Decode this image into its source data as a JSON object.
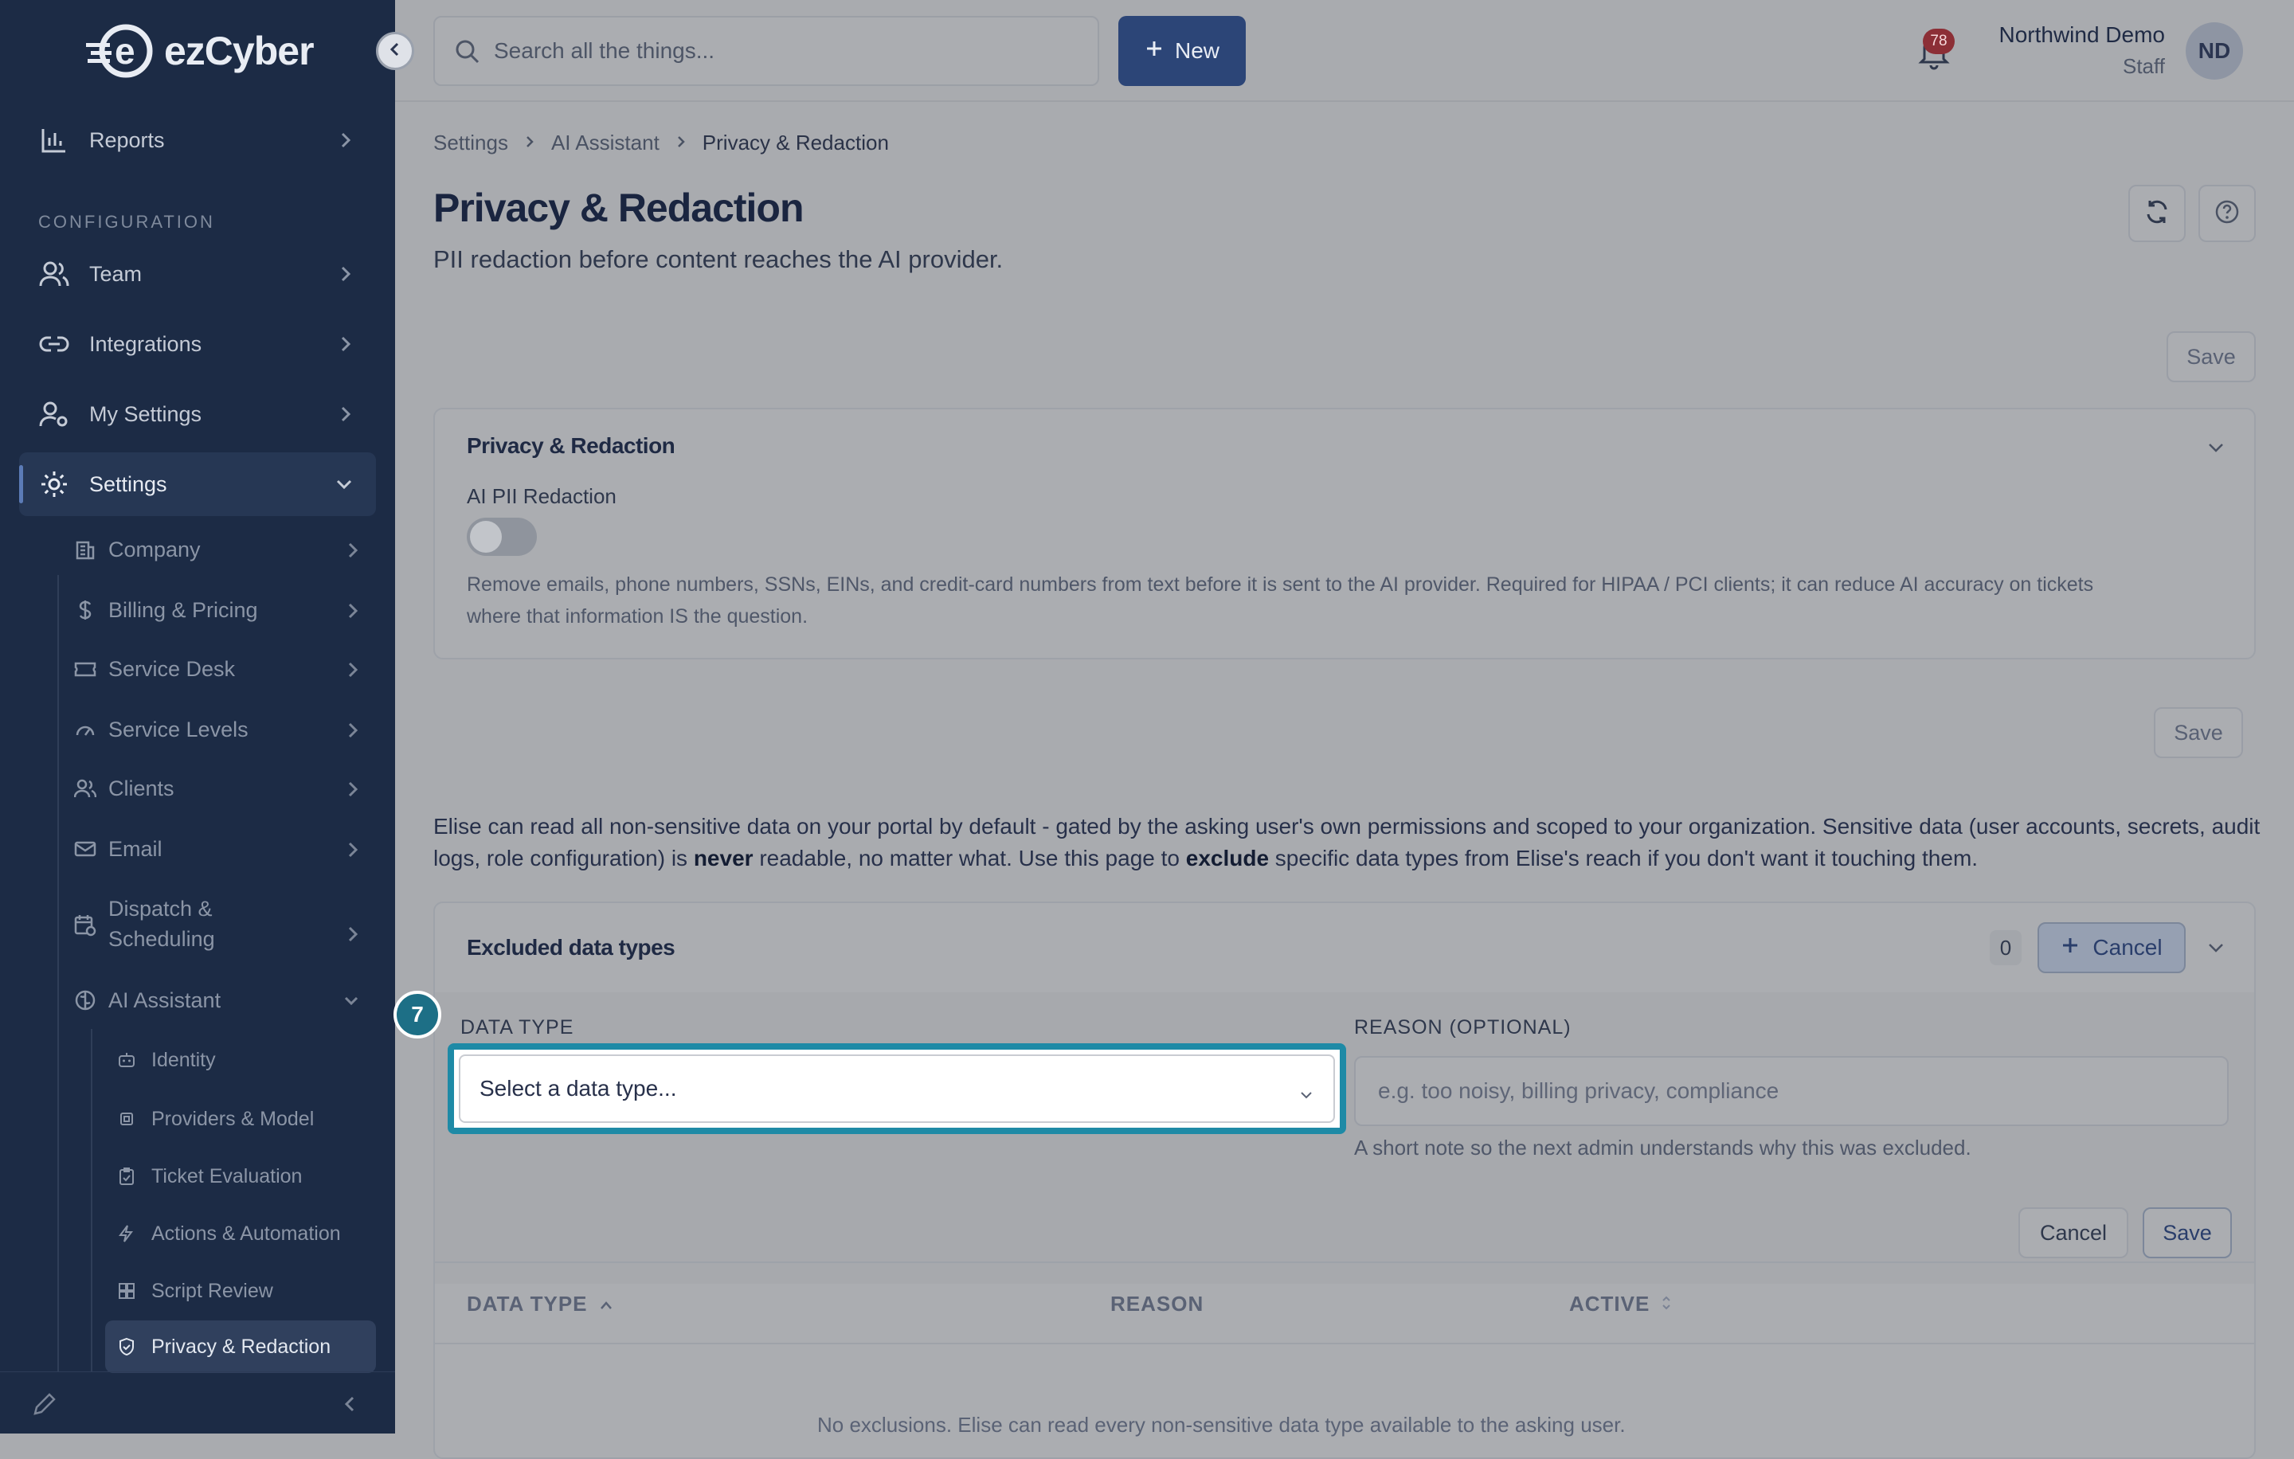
{
  "brand": {
    "name": "ezCyber"
  },
  "search": {
    "placeholder": "Search all the things..."
  },
  "topbar": {
    "new_label": "New",
    "notifications_count": "78"
  },
  "user": {
    "name": "Northwind Demo",
    "role": "Staff",
    "initials": "ND"
  },
  "sidebar": {
    "reports": "Reports",
    "section_configuration": "CONFIGURATION",
    "team": "Team",
    "integrations": "Integrations",
    "my_settings": "My Settings",
    "settings": "Settings",
    "settings_items": [
      {
        "label": "Company"
      },
      {
        "label": "Billing & Pricing"
      },
      {
        "label": "Service Desk"
      },
      {
        "label": "Service Levels"
      },
      {
        "label": "Clients"
      },
      {
        "label": "Email"
      },
      {
        "label": "Dispatch &"
      },
      {
        "label": "Scheduling"
      },
      {
        "label": "AI Assistant"
      }
    ],
    "ai_items": [
      {
        "label": "Identity"
      },
      {
        "label": "Providers & Model"
      },
      {
        "label": "Ticket Evaluation"
      },
      {
        "label": "Actions & Automation"
      },
      {
        "label": "Script Review"
      },
      {
        "label": "Privacy & Redaction"
      }
    ]
  },
  "breadcrumb": {
    "items": [
      "Settings",
      "AI Assistant",
      "Privacy & Redaction"
    ]
  },
  "page": {
    "title": "Privacy & Redaction",
    "subtitle": "PII redaction before content reaches the AI provider.",
    "save_label": "Save"
  },
  "privacy_card": {
    "title": "Privacy & Redaction",
    "toggle_label": "AI PII Redaction",
    "toggle_on": false,
    "help_line1": "Remove emails, phone numbers, SSNs, EINs, and credit-card numbers from text before it is sent to the AI provider. Required for HIPAA / PCI clients; it can reduce AI accuracy on tickets",
    "help_line2": "where that information IS the question.",
    "save_label": "Save"
  },
  "info": {
    "part1": "Elise can read all non-sensitive data on your portal by default - gated by the asking user's own permissions and scoped to your organization. Sensitive data (user accounts, secrets, audit logs, role configuration) is ",
    "never": "never",
    "part2": " readable, no matter what. Use this page to ",
    "exclude": "exclude",
    "part3": " specific data types from Elise's reach if you don't want it touching them."
  },
  "excluded_card": {
    "title": "Excluded data types",
    "count": "0",
    "cancel_label": "Cancel",
    "data_type_label": "DATA TYPE",
    "data_type_placeholder": "Select a data type...",
    "reason_label": "REASON (OPTIONAL)",
    "reason_placeholder": "e.g. too noisy, billing privacy, compliance",
    "reason_help": "A short note so the next admin understands why this was excluded.",
    "form_cancel": "Cancel",
    "form_save": "Save",
    "columns": [
      "DATA TYPE",
      "REASON",
      "ACTIVE"
    ],
    "empty_text": "No exclusions. Elise can read every non-sensitive data type available to the asking user."
  },
  "step_badge": "7"
}
